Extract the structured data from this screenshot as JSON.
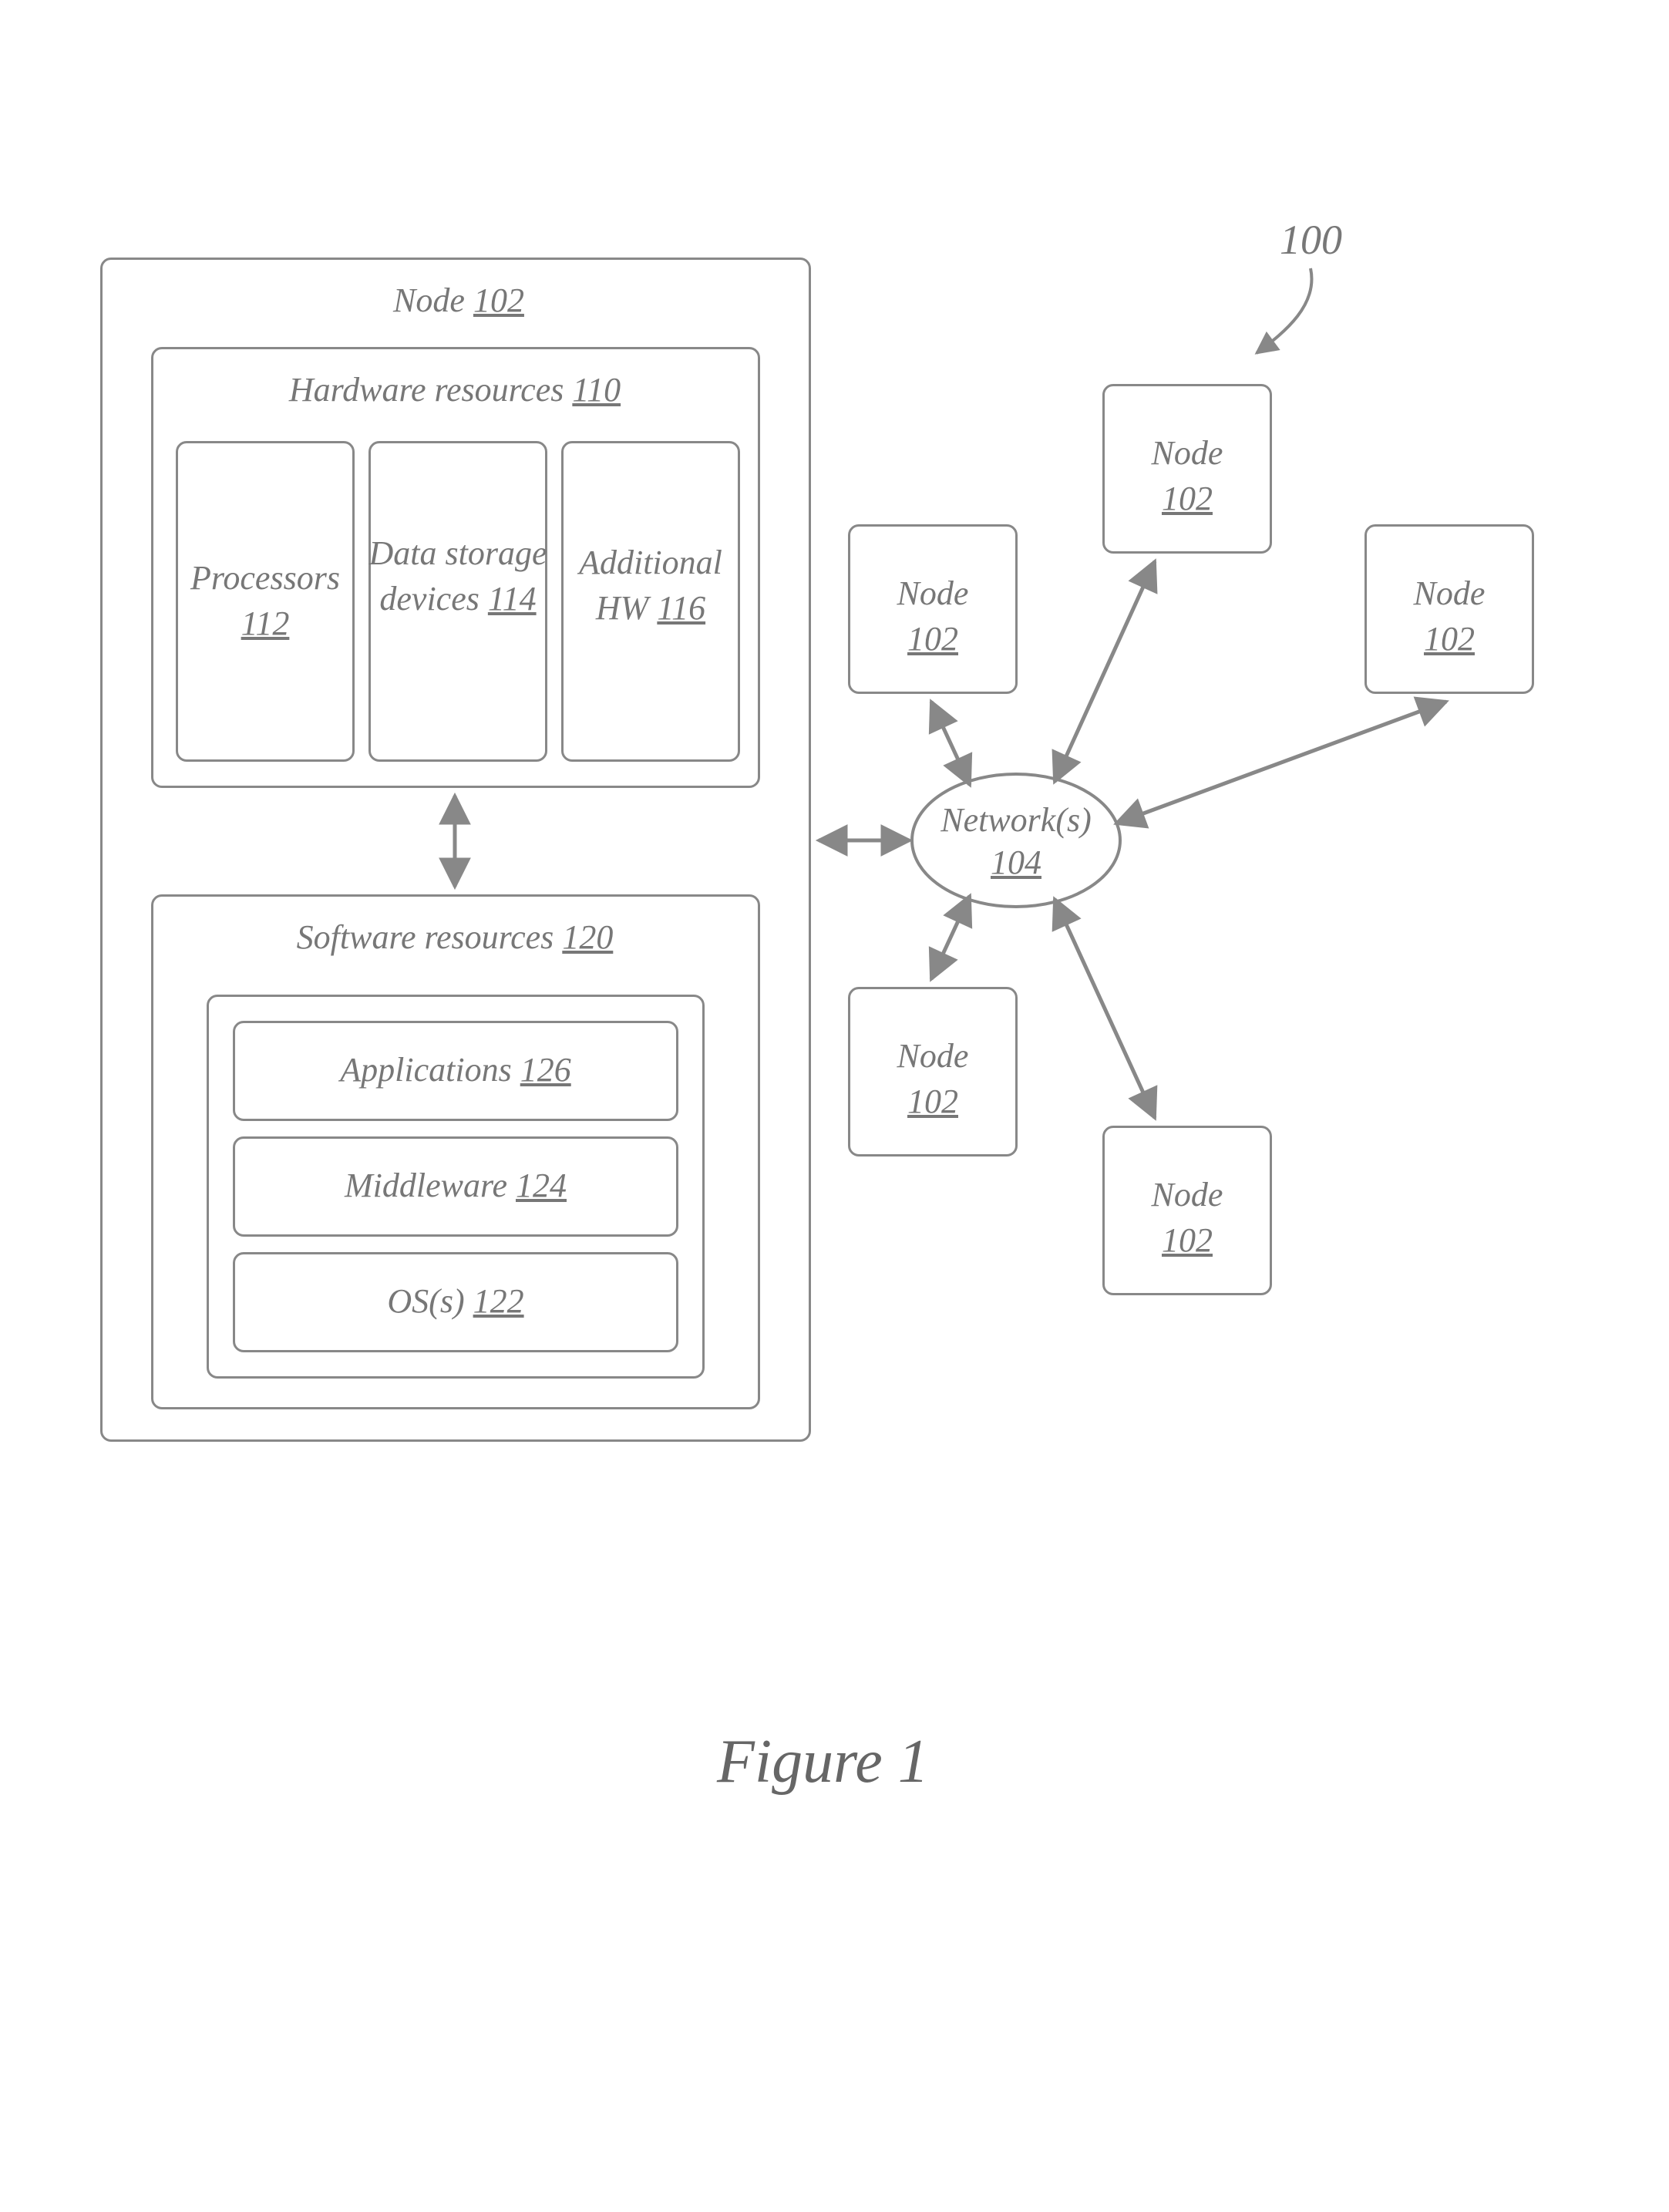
{
  "diagram_ref": "100",
  "figure_caption": "Figure 1",
  "main_node": {
    "title": "Node",
    "ref": "102",
    "hardware": {
      "title": "Hardware resources",
      "ref": "110",
      "processors": {
        "title": "Processors",
        "ref": "112"
      },
      "data_storage": {
        "title": "Data storage devices",
        "ref": "114"
      },
      "additional_hw": {
        "title": "Additional HW",
        "ref": "116"
      }
    },
    "software": {
      "title": "Software resources",
      "ref": "120",
      "applications": {
        "title": "Applications",
        "ref": "126"
      },
      "middleware": {
        "title": "Middleware",
        "ref": "124"
      },
      "os": {
        "title": "OS(s)",
        "ref": "122"
      }
    }
  },
  "network": {
    "title": "Network(s)",
    "ref": "104"
  },
  "peripheral_nodes": [
    {
      "title": "Node",
      "ref": "102"
    },
    {
      "title": "Node",
      "ref": "102"
    },
    {
      "title": "Node",
      "ref": "102"
    },
    {
      "title": "Node",
      "ref": "102"
    },
    {
      "title": "Node",
      "ref": "102"
    }
  ]
}
